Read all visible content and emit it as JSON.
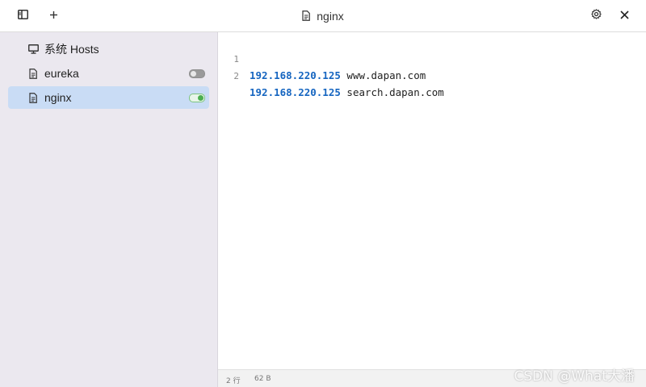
{
  "titlebar": {
    "title": "nginx",
    "icons": {
      "sidebar_toggle": "sidebar-panel-icon",
      "add": "plus-icon",
      "settings": "gear-icon",
      "close": "close-icon"
    }
  },
  "sidebar": {
    "items": [
      {
        "label": "系统 Hosts",
        "icon": "monitor-icon",
        "active": false,
        "has_toggle": false
      },
      {
        "label": "eureka",
        "icon": "file-icon",
        "active": false,
        "has_toggle": true,
        "enabled": false
      },
      {
        "label": "nginx",
        "icon": "file-icon",
        "active": true,
        "has_toggle": true,
        "enabled": true
      }
    ]
  },
  "editor": {
    "lines": [
      {
        "number": "1",
        "ip": "192.168.220.125",
        "host": "www.dapan.com"
      },
      {
        "number": "2",
        "ip": "192.168.220.125",
        "host": "search.dapan.com"
      }
    ]
  },
  "statusbar": {
    "lines": "2 行",
    "size": "62 B"
  },
  "watermark": "CSDN @What大潘",
  "colors": {
    "active_item_bg": "#c9dcf5",
    "sidebar_bg": "#ebe8ef",
    "ip_color": "#1565c0",
    "toggle_on": "#4caf50"
  }
}
